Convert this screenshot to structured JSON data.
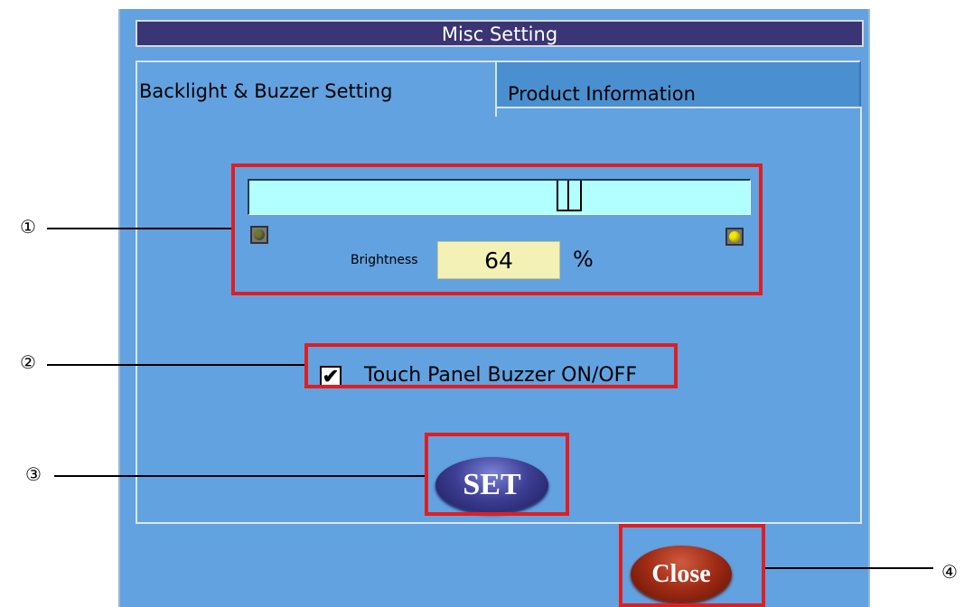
{
  "window": {
    "title": "Misc Setting",
    "tabs": [
      {
        "label": "Backlight & Buzzer Setting",
        "active": true
      },
      {
        "label": "Product Information",
        "active": false
      }
    ]
  },
  "backlight": {
    "brightness_label": "Brightness",
    "brightness_value": "64",
    "brightness_unit": "%",
    "slider_fraction": 0.64,
    "dim_lamp_icon": "dim-lamp-icon",
    "bright_lamp_icon": "bright-lamp-icon"
  },
  "buzzer": {
    "label": "Touch Panel Buzzer ON/OFF",
    "checked": true,
    "check_glyph": "✔"
  },
  "buttons": {
    "set_label": "SET",
    "close_label": "Close"
  },
  "callouts": [
    "①",
    "②",
    "③",
    "④"
  ],
  "colors": {
    "window_bg": "#62a2e0",
    "titlebar_bg": "#3a3574",
    "highlight_box": "#e01e22",
    "slider_track": "#b2ffff",
    "value_box": "#f3f1b6"
  }
}
